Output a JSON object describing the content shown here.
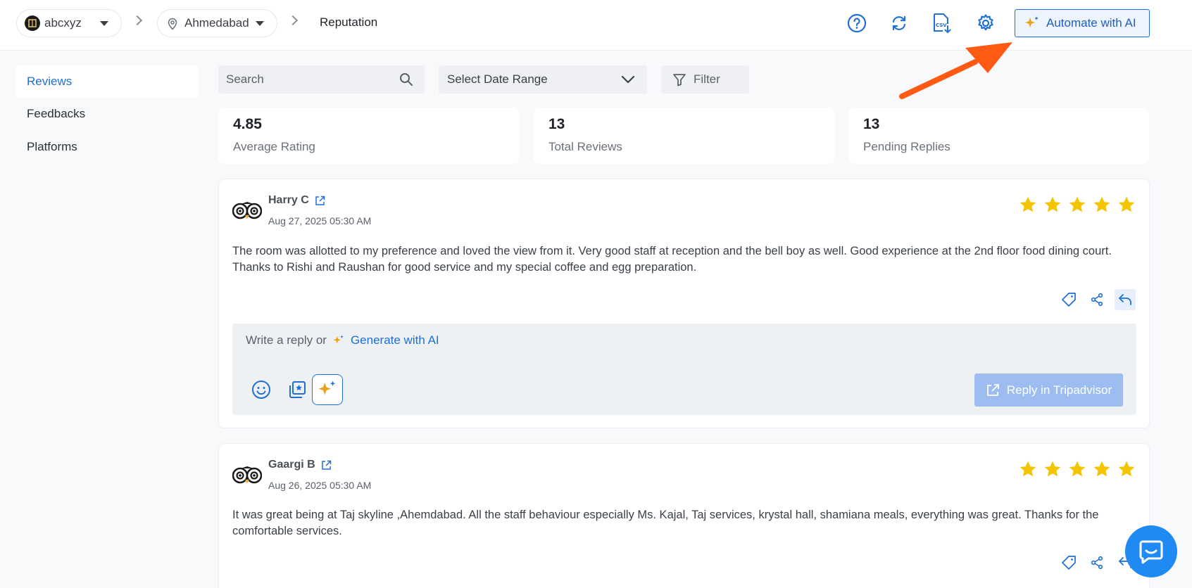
{
  "header": {
    "workspace": "abcxyz",
    "location": "Ahmedabad",
    "current_page": "Reputation",
    "automate_label": "Automate with AI"
  },
  "sidebar": {
    "items": [
      {
        "label": "Reviews",
        "active": true
      },
      {
        "label": "Feedbacks",
        "active": false
      },
      {
        "label": "Platforms",
        "active": false
      }
    ]
  },
  "filters": {
    "search_placeholder": "Search",
    "date_range_label": "Select Date Range",
    "filter_label": "Filter"
  },
  "stats": [
    {
      "value": "4.85",
      "label": "Average Rating"
    },
    {
      "value": "13",
      "label": "Total Reviews"
    },
    {
      "value": "13",
      "label": "Pending Replies"
    }
  ],
  "reviews": [
    {
      "author": "Harry C",
      "date": "Aug 27, 2025 05:30 AM",
      "rating": 5,
      "platform_icon": "tripadvisor-owl-icon",
      "text": "The room was allotted to my preference and loved the view from it. Very good staff at reception and the bell boy as well. Good experience at the 2nd floor food dining court. Thanks to Rishi and Raushan for good service and my special coffee and egg preparation.",
      "reply_prompt": "Write a reply or",
      "generate_label": "Generate with AI",
      "reply_button": "Reply in Tripadvisor"
    },
    {
      "author": "Gaargi B",
      "date": "Aug 26, 2025 05:30 AM",
      "rating": 5,
      "platform_icon": "tripadvisor-owl-icon",
      "text": "It was great being at Taj skyline ,Ahemdabad. All the staff behaviour especially Ms. Kajal, Taj services, krystal hall, shamiana meals, everything was great. Thanks for the comfortable services."
    }
  ],
  "colors": {
    "accent": "#1f6fd6",
    "star": "#f5c400",
    "arrow": "#ff5a14",
    "chat": "#1e8af2"
  }
}
